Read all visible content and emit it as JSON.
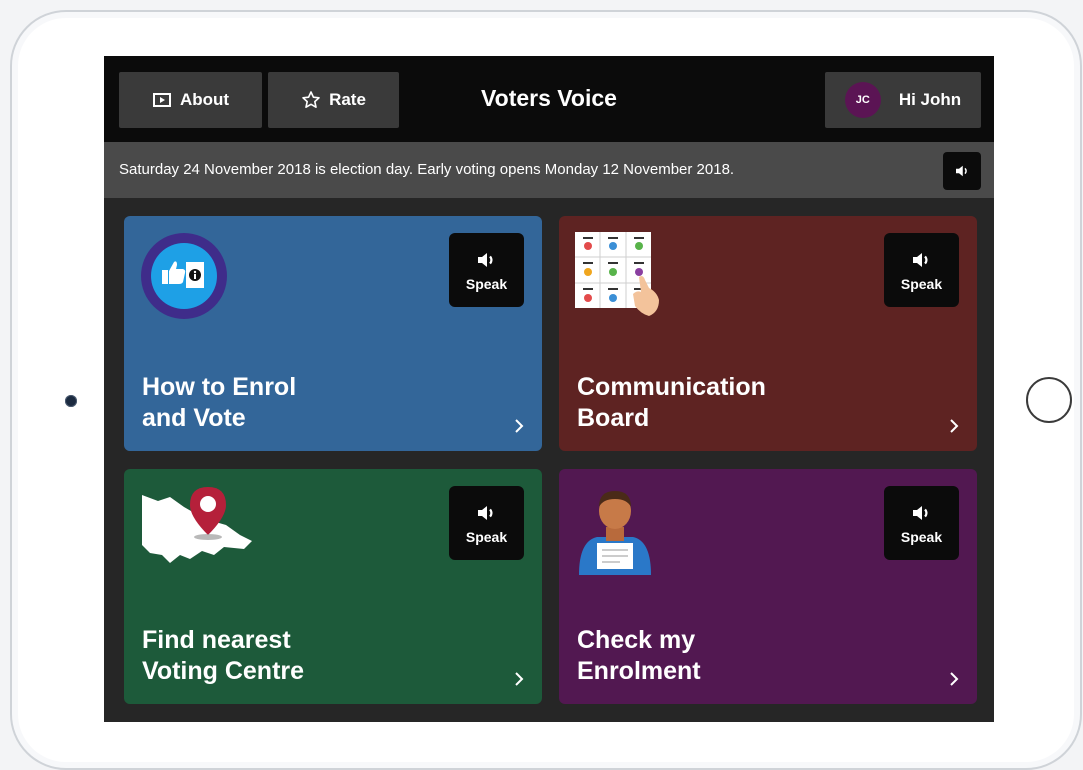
{
  "header": {
    "about_label": "About",
    "rate_label": "Rate",
    "app_title": "Voters Voice",
    "user_initials": "JC",
    "greeting": "Hi John"
  },
  "notice": {
    "text": "Saturday 24 November 2018 is election day. Early voting opens Monday 12 November 2018."
  },
  "cards": [
    {
      "title_line1": "How to Enrol",
      "title_line2": "and Vote",
      "speak_label": "Speak",
      "color": "#336699"
    },
    {
      "title_line1": "Communication",
      "title_line2": "Board",
      "speak_label": "Speak",
      "color": "#5e2322"
    },
    {
      "title_line1": "Find nearest",
      "title_line2": "Voting Centre",
      "speak_label": "Speak",
      "color": "#1d5a3a"
    },
    {
      "title_line1": "Check my",
      "title_line2": "Enrolment",
      "speak_label": "Speak",
      "color": "#521851"
    }
  ],
  "icons": {
    "about": "play-square-icon",
    "rate": "star-outline-icon",
    "speaker": "speaker-icon",
    "chevron": "chevron-right-icon"
  }
}
